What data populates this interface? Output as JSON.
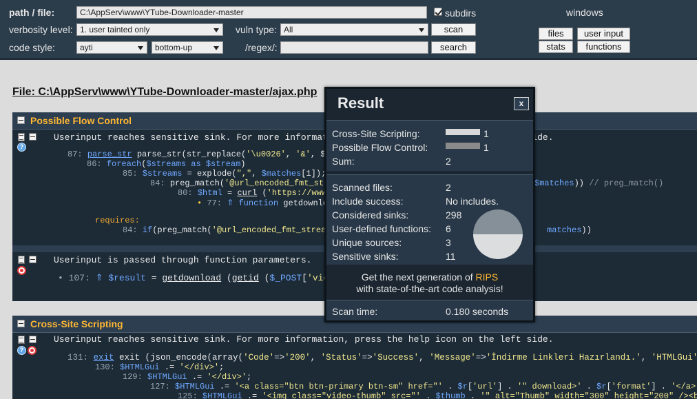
{
  "menu": {
    "path_label": "path / file:",
    "path_value": "C:\\AppServ\\www\\YTube-Downloader-master",
    "subdirs_label": "subdirs",
    "windows_label": "windows",
    "verbosity_label": "verbosity level:",
    "verbosity_value": "1. user tainted only",
    "vulntype_label": "vuln type:",
    "vulntype_value": "All",
    "scan_button": "scan",
    "codestyle_label": "code style:",
    "codestyle_value": "ayti",
    "codestyle2_value": "bottom-up",
    "regex_label": "/regex/:",
    "regex_value": "",
    "search_button": "search",
    "files_button": "files",
    "userinput_button": "user input",
    "stats_button": "stats",
    "functions_button": "functions"
  },
  "file_title": "File: C:\\AppServ\\www\\YTube-Downloader-master/ajax.php",
  "sections": {
    "flow": {
      "title": "Possible Flow Control",
      "msg1": "Userinput reaches sensitive sink. For more information, press the help icon on the left side.",
      "msg2": "Userinput is passed through function parameters.",
      "requires": "requires:"
    },
    "xss": {
      "title": "Cross-Site Scripting",
      "msg1": "Userinput reaches sensitive sink. For more information, press the help icon on the left side."
    }
  },
  "result": {
    "title": "Result",
    "close": "x",
    "xss_label": "Cross-Site Scripting:",
    "xss_value": "1",
    "flow_label": "Possible Flow Control:",
    "flow_value": "1",
    "sum_label": "Sum:",
    "sum_value": "2",
    "scanned_label": "Scanned files:",
    "scanned_value": "2",
    "include_label": "Include success:",
    "include_value": "No includes.",
    "sinks_label": "Considered sinks:",
    "sinks_value": "298",
    "udf_label": "User-defined functions:",
    "udf_value": "6",
    "sources_label": "Unique sources:",
    "sources_value": "3",
    "sensitive_label": "Sensitive sinks:",
    "sensitive_value": "11",
    "promo_line1": "Get the next generation of",
    "promo_brand": "RIPS",
    "promo_line2": "with state-of-the-art code analysis!",
    "scantime_label": "Scan time:",
    "scantime_value": "0.180 seconds"
  },
  "colors": {
    "menu_bg": "#2b3c4b",
    "section_title": "#ffb733",
    "code_bg": "#1d2b37",
    "keyword": "#6fa8ff",
    "string": "#f0e68c"
  }
}
